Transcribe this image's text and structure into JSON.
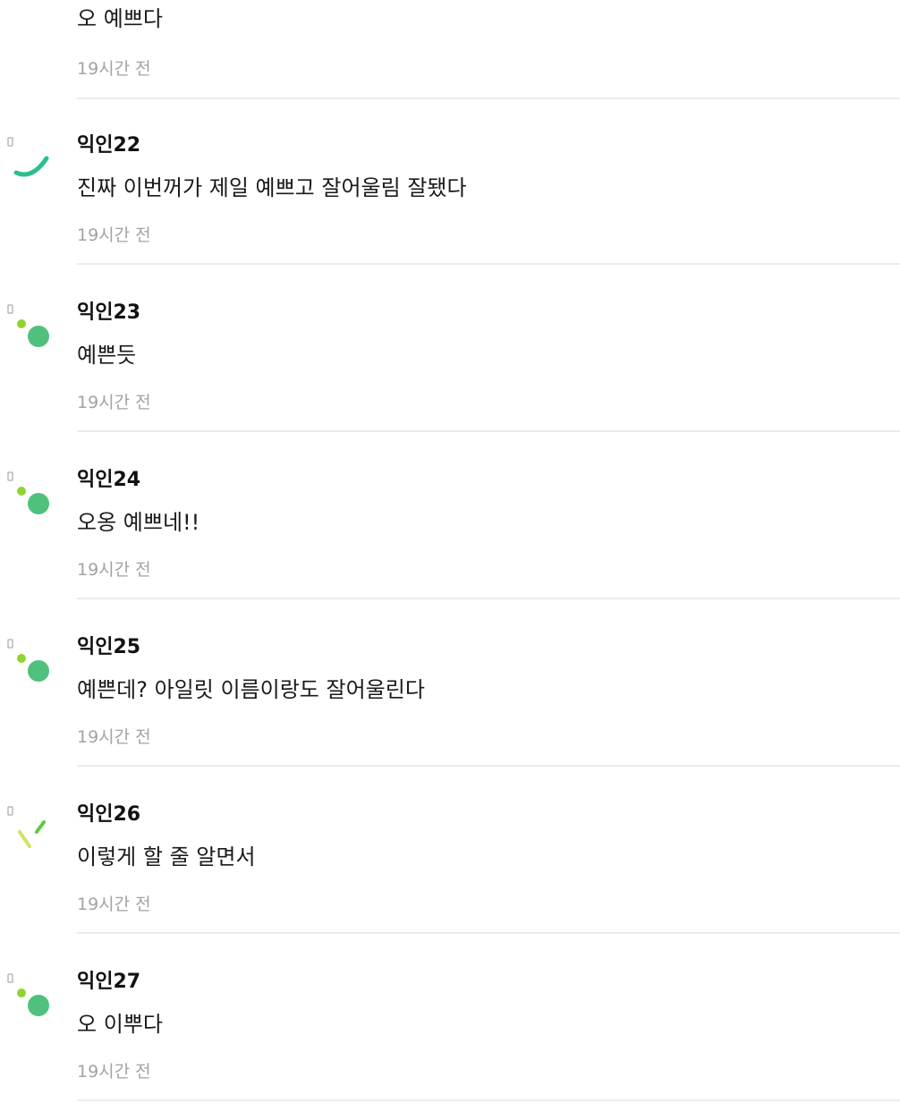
{
  "comments": [
    {
      "author": "",
      "body": "오 예쁘다",
      "time": "19시간 전",
      "avatar_icon": "yellow-slash-icon"
    },
    {
      "author": "익인22",
      "body": "진짜 이번꺼가 제일 예쁘고 잘어울림 잘됐다",
      "time": "19시간 전",
      "avatar_icon": "teal-arc-icon"
    },
    {
      "author": "익인23",
      "body": "예쁜듯",
      "time": "19시간 전",
      "avatar_icon": "green-dots-icon"
    },
    {
      "author": "익인24",
      "body": "오옹 예쁘네!!",
      "time": "19시간 전",
      "avatar_icon": "green-dots-icon"
    },
    {
      "author": "익인25",
      "body": "예쁜데? 아일릿 이름이랑도 잘어울린다",
      "time": "19시간 전",
      "avatar_icon": "green-dots-icon"
    },
    {
      "author": "익인26",
      "body": "이렇게 할 줄 알면서",
      "time": "19시간 전",
      "avatar_icon": "green-lines-icon"
    },
    {
      "author": "익인27",
      "body": "오 이뿌다",
      "time": "19시간 전",
      "avatar_icon": "green-dots-icon"
    }
  ],
  "colors": {
    "avatar_teal": "#2bbf8a",
    "avatar_green": "#4fc17c",
    "avatar_lime": "#8fd42f",
    "avatar_yellow": "#d4e26a"
  }
}
